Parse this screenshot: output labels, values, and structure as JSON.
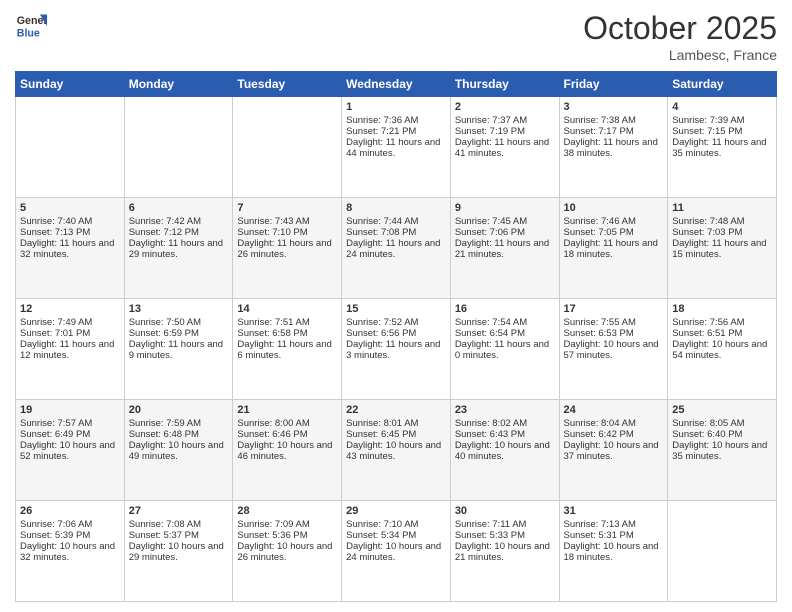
{
  "header": {
    "logo_general": "General",
    "logo_blue": "Blue",
    "month_title": "October 2025",
    "location": "Lambesc, France"
  },
  "days_of_week": [
    "Sunday",
    "Monday",
    "Tuesday",
    "Wednesday",
    "Thursday",
    "Friday",
    "Saturday"
  ],
  "weeks": [
    [
      {
        "day": "",
        "sunrise": "",
        "sunset": "",
        "daylight": ""
      },
      {
        "day": "",
        "sunrise": "",
        "sunset": "",
        "daylight": ""
      },
      {
        "day": "",
        "sunrise": "",
        "sunset": "",
        "daylight": ""
      },
      {
        "day": "1",
        "sunrise": "Sunrise: 7:36 AM",
        "sunset": "Sunset: 7:21 PM",
        "daylight": "Daylight: 11 hours and 44 minutes."
      },
      {
        "day": "2",
        "sunrise": "Sunrise: 7:37 AM",
        "sunset": "Sunset: 7:19 PM",
        "daylight": "Daylight: 11 hours and 41 minutes."
      },
      {
        "day": "3",
        "sunrise": "Sunrise: 7:38 AM",
        "sunset": "Sunset: 7:17 PM",
        "daylight": "Daylight: 11 hours and 38 minutes."
      },
      {
        "day": "4",
        "sunrise": "Sunrise: 7:39 AM",
        "sunset": "Sunset: 7:15 PM",
        "daylight": "Daylight: 11 hours and 35 minutes."
      }
    ],
    [
      {
        "day": "5",
        "sunrise": "Sunrise: 7:40 AM",
        "sunset": "Sunset: 7:13 PM",
        "daylight": "Daylight: 11 hours and 32 minutes."
      },
      {
        "day": "6",
        "sunrise": "Sunrise: 7:42 AM",
        "sunset": "Sunset: 7:12 PM",
        "daylight": "Daylight: 11 hours and 29 minutes."
      },
      {
        "day": "7",
        "sunrise": "Sunrise: 7:43 AM",
        "sunset": "Sunset: 7:10 PM",
        "daylight": "Daylight: 11 hours and 26 minutes."
      },
      {
        "day": "8",
        "sunrise": "Sunrise: 7:44 AM",
        "sunset": "Sunset: 7:08 PM",
        "daylight": "Daylight: 11 hours and 24 minutes."
      },
      {
        "day": "9",
        "sunrise": "Sunrise: 7:45 AM",
        "sunset": "Sunset: 7:06 PM",
        "daylight": "Daylight: 11 hours and 21 minutes."
      },
      {
        "day": "10",
        "sunrise": "Sunrise: 7:46 AM",
        "sunset": "Sunset: 7:05 PM",
        "daylight": "Daylight: 11 hours and 18 minutes."
      },
      {
        "day": "11",
        "sunrise": "Sunrise: 7:48 AM",
        "sunset": "Sunset: 7:03 PM",
        "daylight": "Daylight: 11 hours and 15 minutes."
      }
    ],
    [
      {
        "day": "12",
        "sunrise": "Sunrise: 7:49 AM",
        "sunset": "Sunset: 7:01 PM",
        "daylight": "Daylight: 11 hours and 12 minutes."
      },
      {
        "day": "13",
        "sunrise": "Sunrise: 7:50 AM",
        "sunset": "Sunset: 6:59 PM",
        "daylight": "Daylight: 11 hours and 9 minutes."
      },
      {
        "day": "14",
        "sunrise": "Sunrise: 7:51 AM",
        "sunset": "Sunset: 6:58 PM",
        "daylight": "Daylight: 11 hours and 6 minutes."
      },
      {
        "day": "15",
        "sunrise": "Sunrise: 7:52 AM",
        "sunset": "Sunset: 6:56 PM",
        "daylight": "Daylight: 11 hours and 3 minutes."
      },
      {
        "day": "16",
        "sunrise": "Sunrise: 7:54 AM",
        "sunset": "Sunset: 6:54 PM",
        "daylight": "Daylight: 11 hours and 0 minutes."
      },
      {
        "day": "17",
        "sunrise": "Sunrise: 7:55 AM",
        "sunset": "Sunset: 6:53 PM",
        "daylight": "Daylight: 10 hours and 57 minutes."
      },
      {
        "day": "18",
        "sunrise": "Sunrise: 7:56 AM",
        "sunset": "Sunset: 6:51 PM",
        "daylight": "Daylight: 10 hours and 54 minutes."
      }
    ],
    [
      {
        "day": "19",
        "sunrise": "Sunrise: 7:57 AM",
        "sunset": "Sunset: 6:49 PM",
        "daylight": "Daylight: 10 hours and 52 minutes."
      },
      {
        "day": "20",
        "sunrise": "Sunrise: 7:59 AM",
        "sunset": "Sunset: 6:48 PM",
        "daylight": "Daylight: 10 hours and 49 minutes."
      },
      {
        "day": "21",
        "sunrise": "Sunrise: 8:00 AM",
        "sunset": "Sunset: 6:46 PM",
        "daylight": "Daylight: 10 hours and 46 minutes."
      },
      {
        "day": "22",
        "sunrise": "Sunrise: 8:01 AM",
        "sunset": "Sunset: 6:45 PM",
        "daylight": "Daylight: 10 hours and 43 minutes."
      },
      {
        "day": "23",
        "sunrise": "Sunrise: 8:02 AM",
        "sunset": "Sunset: 6:43 PM",
        "daylight": "Daylight: 10 hours and 40 minutes."
      },
      {
        "day": "24",
        "sunrise": "Sunrise: 8:04 AM",
        "sunset": "Sunset: 6:42 PM",
        "daylight": "Daylight: 10 hours and 37 minutes."
      },
      {
        "day": "25",
        "sunrise": "Sunrise: 8:05 AM",
        "sunset": "Sunset: 6:40 PM",
        "daylight": "Daylight: 10 hours and 35 minutes."
      }
    ],
    [
      {
        "day": "26",
        "sunrise": "Sunrise: 7:06 AM",
        "sunset": "Sunset: 5:39 PM",
        "daylight": "Daylight: 10 hours and 32 minutes."
      },
      {
        "day": "27",
        "sunrise": "Sunrise: 7:08 AM",
        "sunset": "Sunset: 5:37 PM",
        "daylight": "Daylight: 10 hours and 29 minutes."
      },
      {
        "day": "28",
        "sunrise": "Sunrise: 7:09 AM",
        "sunset": "Sunset: 5:36 PM",
        "daylight": "Daylight: 10 hours and 26 minutes."
      },
      {
        "day": "29",
        "sunrise": "Sunrise: 7:10 AM",
        "sunset": "Sunset: 5:34 PM",
        "daylight": "Daylight: 10 hours and 24 minutes."
      },
      {
        "day": "30",
        "sunrise": "Sunrise: 7:11 AM",
        "sunset": "Sunset: 5:33 PM",
        "daylight": "Daylight: 10 hours and 21 minutes."
      },
      {
        "day": "31",
        "sunrise": "Sunrise: 7:13 AM",
        "sunset": "Sunset: 5:31 PM",
        "daylight": "Daylight: 10 hours and 18 minutes."
      },
      {
        "day": "",
        "sunrise": "",
        "sunset": "",
        "daylight": ""
      }
    ]
  ]
}
